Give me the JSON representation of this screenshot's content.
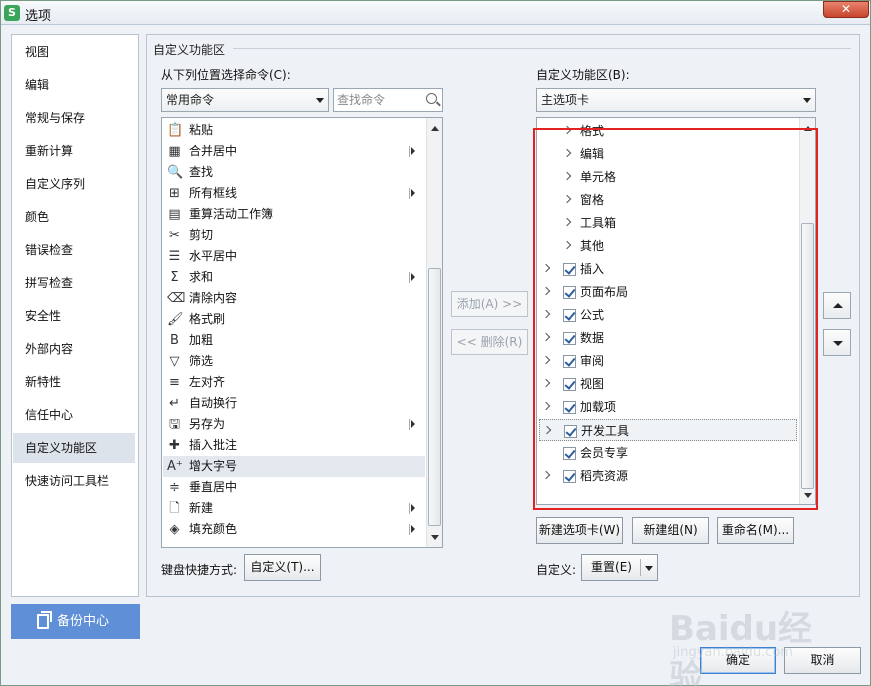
{
  "window": {
    "app_icon": "S",
    "title": "选项",
    "close_label": "✕"
  },
  "sidebar": {
    "items": [
      {
        "label": "视图"
      },
      {
        "label": "编辑"
      },
      {
        "label": "常规与保存"
      },
      {
        "label": "重新计算"
      },
      {
        "label": "自定义序列"
      },
      {
        "label": "颜色"
      },
      {
        "label": "错误检查"
      },
      {
        "label": "拼写检查"
      },
      {
        "label": "安全性"
      },
      {
        "label": "外部内容"
      },
      {
        "label": "新特性"
      },
      {
        "label": "信任中心"
      },
      {
        "label": "自定义功能区",
        "active": true
      },
      {
        "label": "快速访问工具栏"
      }
    ],
    "backup_label": "备份中心"
  },
  "panel": {
    "section_title": "自定义功能区",
    "choose_from_label": "从下列位置选择命令(C):",
    "choose_from_value": "常用命令",
    "search_placeholder": "查找命令",
    "customize_label": "自定义功能区(B):",
    "customize_value": "主选项卡"
  },
  "commands": [
    {
      "label": "粘贴",
      "icon": "paste-icon",
      "glyph": "📋",
      "submenu": false
    },
    {
      "label": "合并居中",
      "icon": "merge-center-icon",
      "glyph": "▦",
      "submenu": true
    },
    {
      "label": "查找",
      "icon": "find-icon",
      "glyph": "🔍",
      "submenu": false
    },
    {
      "label": "所有框线",
      "icon": "all-borders-icon",
      "glyph": "⊞",
      "submenu": true
    },
    {
      "label": "重算活动工作簿",
      "icon": "recalc-workbook-icon",
      "glyph": "▤",
      "submenu": false
    },
    {
      "label": "剪切",
      "icon": "cut-icon",
      "glyph": "✂",
      "submenu": false
    },
    {
      "label": "水平居中",
      "icon": "align-center-icon",
      "glyph": "☰",
      "submenu": false
    },
    {
      "label": "求和",
      "icon": "sum-icon",
      "glyph": "Σ",
      "submenu": true
    },
    {
      "label": "清除内容",
      "icon": "clear-content-icon",
      "glyph": "⌫",
      "submenu": false
    },
    {
      "label": "格式刷",
      "icon": "format-painter-icon",
      "glyph": "🖌",
      "submenu": false
    },
    {
      "label": "加粗",
      "icon": "bold-icon",
      "glyph": "B",
      "submenu": false
    },
    {
      "label": "筛选",
      "icon": "filter-icon",
      "glyph": "▽",
      "submenu": false
    },
    {
      "label": "左对齐",
      "icon": "align-left-icon",
      "glyph": "≡",
      "submenu": false
    },
    {
      "label": "自动换行",
      "icon": "wrap-text-icon",
      "glyph": "↵",
      "submenu": false
    },
    {
      "label": "另存为",
      "icon": "save-as-icon",
      "glyph": "🖫",
      "submenu": true
    },
    {
      "label": "插入批注",
      "icon": "insert-comment-icon",
      "glyph": "✚",
      "submenu": false
    },
    {
      "label": "增大字号",
      "icon": "increase-font-icon",
      "glyph": "A⁺",
      "submenu": false,
      "highlighted": true
    },
    {
      "label": "垂直居中",
      "icon": "vertical-center-icon",
      "glyph": "≑",
      "submenu": false
    },
    {
      "label": "新建",
      "icon": "new-doc-icon",
      "glyph": "🗋",
      "submenu": true
    },
    {
      "label": "填充颜色",
      "icon": "fill-color-icon",
      "glyph": "◈",
      "submenu": true
    }
  ],
  "middle_buttons": {
    "add": "添加(A) >>",
    "remove": "<< 删除(R)"
  },
  "tree": [
    {
      "label": "格式",
      "level": 2,
      "checkbox": false
    },
    {
      "label": "编辑",
      "level": 2,
      "checkbox": false
    },
    {
      "label": "单元格",
      "level": 2,
      "checkbox": false
    },
    {
      "label": "窗格",
      "level": 2,
      "checkbox": false
    },
    {
      "label": "工具箱",
      "level": 2,
      "checkbox": false
    },
    {
      "label": "其他",
      "level": 2,
      "checkbox": false
    },
    {
      "label": "插入",
      "level": 1,
      "checkbox": true,
      "checked": true,
      "expander": true
    },
    {
      "label": "页面布局",
      "level": 1,
      "checkbox": true,
      "checked": true,
      "expander": true
    },
    {
      "label": "公式",
      "level": 1,
      "checkbox": true,
      "checked": true,
      "expander": true
    },
    {
      "label": "数据",
      "level": 1,
      "checkbox": true,
      "checked": true,
      "expander": true
    },
    {
      "label": "审阅",
      "level": 1,
      "checkbox": true,
      "checked": true,
      "expander": true
    },
    {
      "label": "视图",
      "level": 1,
      "checkbox": true,
      "checked": true,
      "expander": true
    },
    {
      "label": "加载项",
      "level": 1,
      "checkbox": true,
      "checked": true,
      "expander": true
    },
    {
      "label": "开发工具",
      "level": 1,
      "checkbox": true,
      "checked": true,
      "expander": true,
      "selected": true
    },
    {
      "label": "会员专享",
      "level": 1,
      "checkbox": true,
      "checked": true,
      "expander": false
    },
    {
      "label": "稻壳资源",
      "level": 1,
      "checkbox": true,
      "checked": true,
      "expander": true
    }
  ],
  "bottom": {
    "shortcut_label": "键盘快捷方式:",
    "shortcut_button": "自定义(T)...",
    "new_tab": "新建选项卡(W)",
    "new_group": "新建组(N)",
    "rename": "重命名(M)...",
    "customize_label": "自定义:",
    "reset": "重置(E)"
  },
  "dialog": {
    "ok": "确定",
    "cancel": "取消"
  },
  "watermark": {
    "main": "Baidu经验",
    "sub": "jingyan.baidu.com"
  },
  "colors": {
    "accent": "#5f8fd6",
    "highlight_box": "#e52222"
  }
}
